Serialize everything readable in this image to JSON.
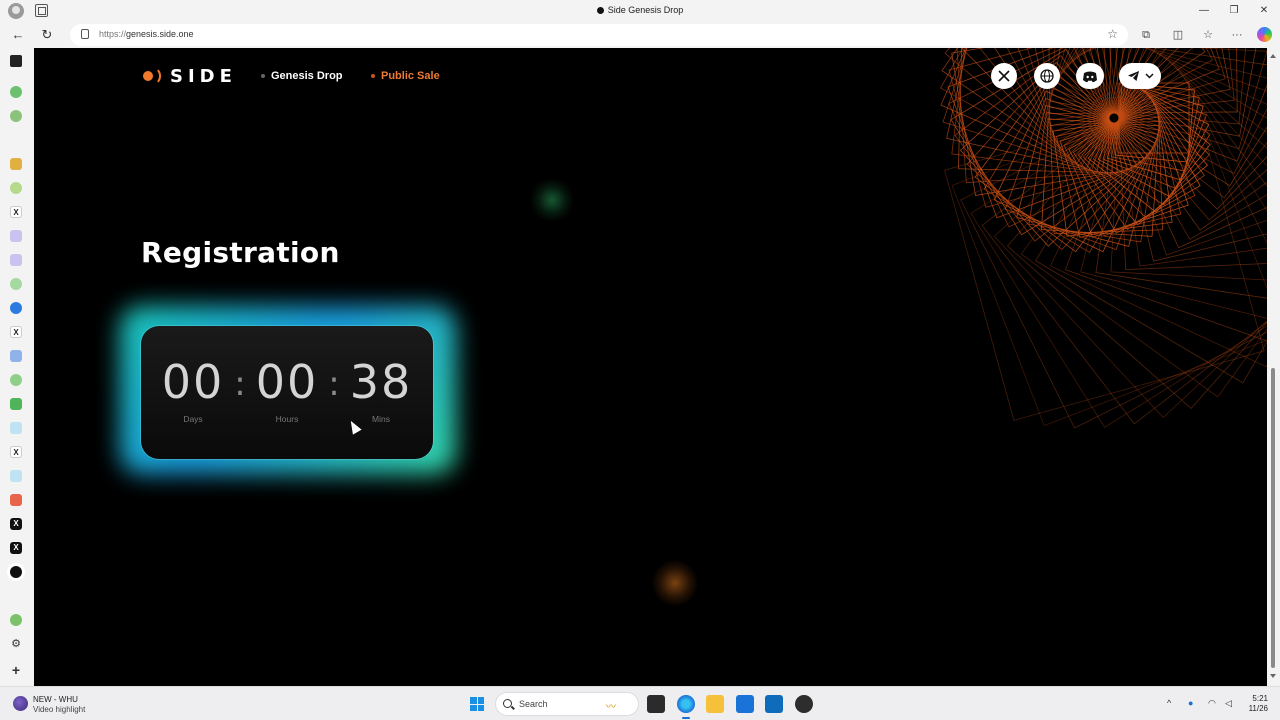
{
  "browser": {
    "tab_title": "Side Genesis Drop",
    "url_protocol": "https://",
    "url_host": "genesis.side.one",
    "window_buttons": {
      "minimize": "—",
      "restore": "❐",
      "close": "✕"
    },
    "nav": {
      "back": "←",
      "refresh": "↻"
    },
    "toolbar": {
      "extensions": "⧉",
      "split": "◫",
      "favorites": "☆",
      "more": "···"
    }
  },
  "site": {
    "logo_text": "SIDE",
    "nav": [
      {
        "label": "Genesis Drop",
        "color": "#ffffff"
      },
      {
        "label": "Public Sale",
        "color": "#ee7a34"
      }
    ],
    "social": [
      {
        "icon": "x-logo-icon"
      },
      {
        "icon": "globe-icon"
      },
      {
        "icon": "discord-icon"
      },
      {
        "icon": "telegram-icon"
      }
    ],
    "accent_color": "#f07a2a"
  },
  "registration": {
    "title": "Registration",
    "countdown": {
      "days": "00",
      "hours": "00",
      "mins": "38",
      "separator": ":",
      "labels": {
        "days": "Days",
        "hours": "Hours",
        "mins": "Mins"
      }
    }
  },
  "taskbar": {
    "news_title": "NEW - WHU",
    "news_subtitle": "Video highlight",
    "search_placeholder": "Search",
    "time": "5:21",
    "date": "11/26"
  }
}
